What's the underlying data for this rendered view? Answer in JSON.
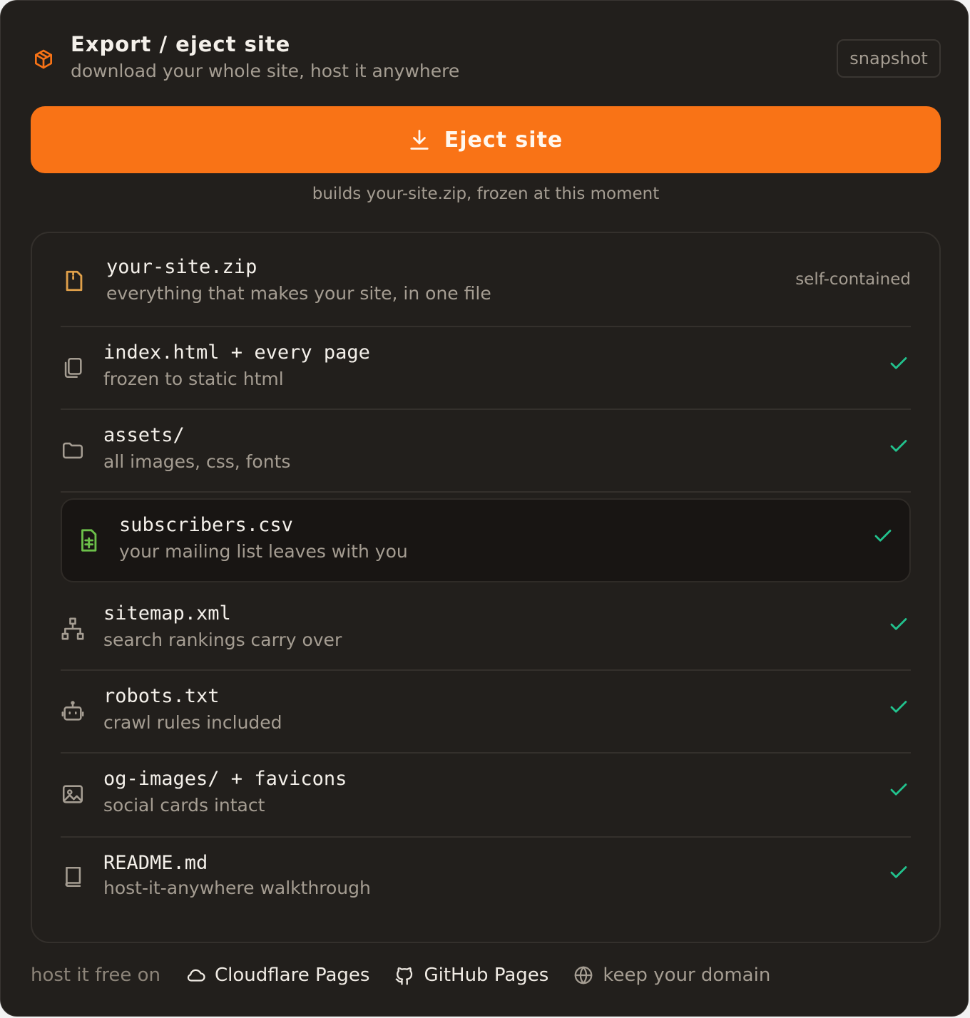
{
  "header": {
    "title": "Export / eject site",
    "subtitle": "download your whole site, host it anywhere",
    "badge": "snapshot",
    "icon": "package-icon"
  },
  "eject": {
    "button_label": "Eject site",
    "button_icon": "download-icon",
    "caption": "builds your-site.zip, frozen at this moment"
  },
  "archive": {
    "name": "your-site.zip",
    "description": "everything that makes your site, in one file",
    "tag": "self-contained",
    "icon": "zip-file-icon"
  },
  "files": [
    {
      "name": "index.html + every page",
      "description": "frozen to static html",
      "icon": "copy-pages-icon",
      "included": true
    },
    {
      "name": "assets/",
      "description": "all images, css, fonts",
      "icon": "folder-icon",
      "included": true
    },
    {
      "name": "subscribers.csv",
      "description": "your mailing list leaves with you",
      "icon": "spreadsheet-file-icon",
      "included": true,
      "highlighted": true
    },
    {
      "name": "sitemap.xml",
      "description": "search rankings carry over",
      "icon": "sitemap-icon",
      "included": true
    },
    {
      "name": "robots.txt",
      "description": "crawl rules included",
      "icon": "robot-icon",
      "included": true
    },
    {
      "name": "og-images/ + favicons",
      "description": "social cards intact",
      "icon": "image-icon",
      "included": true
    },
    {
      "name": "README.md",
      "description": "host-it-anywhere walkthrough",
      "icon": "book-icon",
      "included": true
    }
  ],
  "footer": {
    "lead": "host it free on",
    "links": [
      {
        "label": "Cloudflare Pages",
        "icon": "cloud-icon"
      },
      {
        "label": "GitHub Pages",
        "icon": "github-icon"
      },
      {
        "label": "keep your domain",
        "icon": "globe-icon"
      }
    ]
  },
  "colors": {
    "accent": "#f97316",
    "background": "#221f1c",
    "check": "#22c38e",
    "csv_icon": "#6cc04a"
  }
}
